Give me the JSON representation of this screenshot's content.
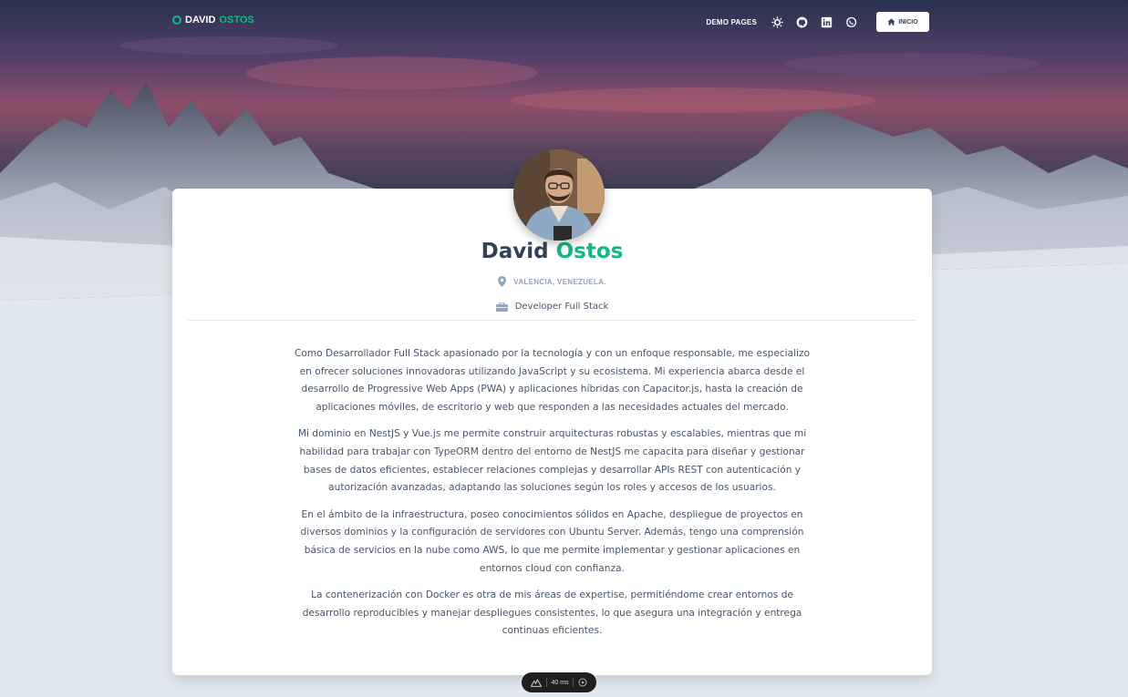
{
  "navbar": {
    "brand_first": "DAVID",
    "brand_last": "OSTOS",
    "demo_pages": "DEMO PAGES",
    "inicio": "INICIO",
    "icons": [
      "sun-icon",
      "github-icon",
      "linkedin-icon",
      "whatsapp-icon"
    ]
  },
  "profile": {
    "first_name": "David",
    "last_name": "Ostos",
    "location": "VALENCIA, VENEZUELA.",
    "role": "Developer Full Stack"
  },
  "bio": [
    "Como Desarrollador Full Stack apasionado por la tecnología y con un enfoque responsable, me especializo en ofrecer soluciones innovadoras utilizando JavaScript y su ecosistema. Mi experiencia abarca desde el desarrollo de Progressive Web Apps (PWA) y aplicaciones híbridas con Capacitor.js, hasta la creación de aplicaciones móviles, de escritorio y web que responden a las necesidades actuales del mercado.",
    "Mi dominio en NestJS y Vue.js me permite construir arquitecturas robustas y escalables, mientras que mi habilidad para trabajar con TypeORM dentro del entorno de NestJS me capacita para diseñar y gestionar bases de datos eficientes, establecer relaciones complejas y desarrollar APIs REST con autenticación y autorización avanzadas, adaptando las soluciones según los roles y accesos de los usuarios.",
    "En el ámbito de la infraestructura, poseo conocimientos sólidos en Apache, despliegue de proyectos en diversos dominios y la configuración de servidores con Ubuntu Server. Además, tengo una comprensión básica de servicios en la nube como AWS, lo que me permite implementar y gestionar aplicaciones en entornos cloud con confianza.",
    "La contenerización con Docker es otra de mis áreas de expertise, permitiéndome crear entornos de desarrollo reproducibles y manejar despliegues consistentes, lo que asegura una integración y entrega continuas eficientes."
  ],
  "devbar": {
    "timing": "40 ms"
  },
  "colors": {
    "accent": "#10b981",
    "page_bg": "#e2e8f0",
    "heading": "#334155"
  }
}
